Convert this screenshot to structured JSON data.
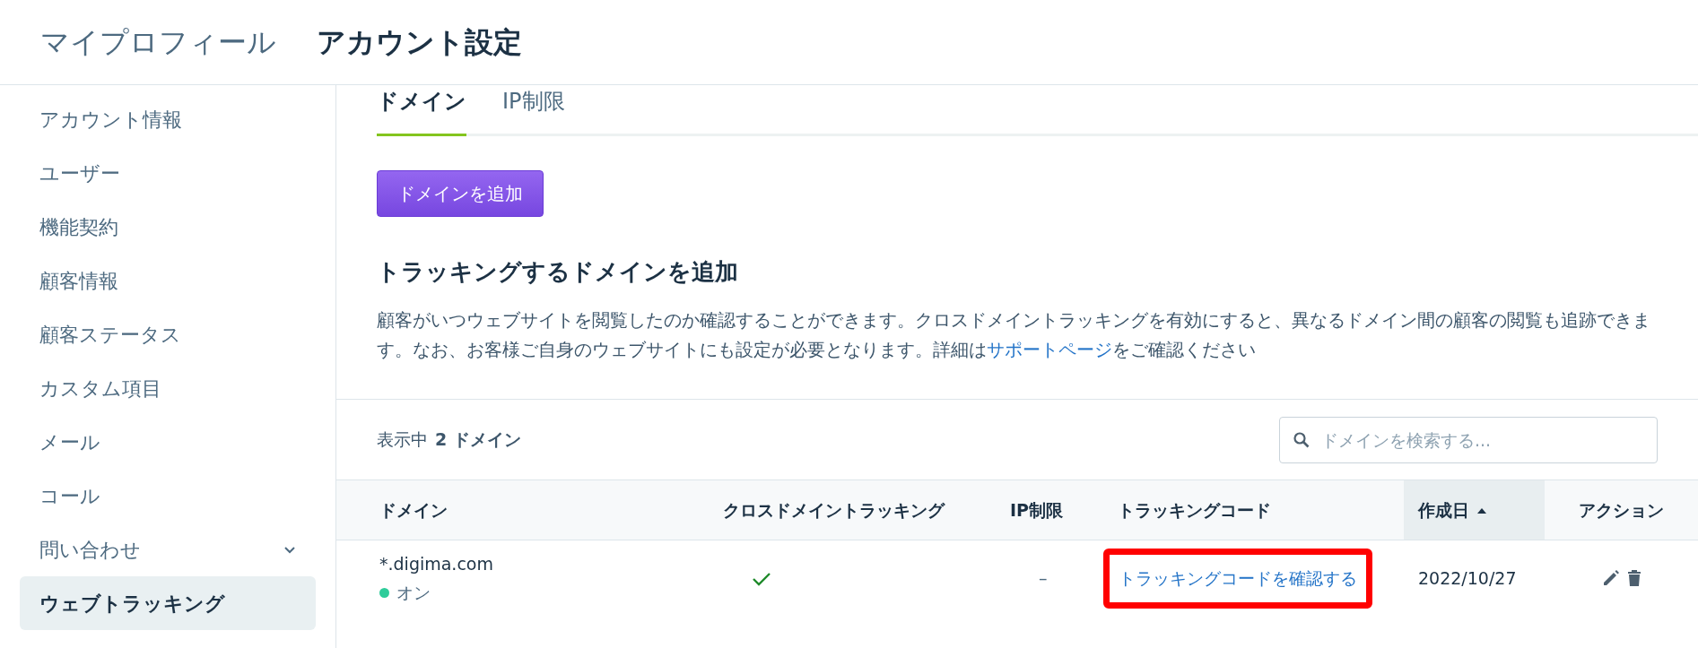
{
  "header": {
    "breadcrumbs": [
      {
        "label": "マイプロフィール",
        "selected": false
      },
      {
        "label": "アカウント設定",
        "selected": true
      }
    ]
  },
  "sidebar": {
    "items": [
      {
        "label": "アカウント情報",
        "selected": false,
        "expandable": false
      },
      {
        "label": "ユーザー",
        "selected": false,
        "expandable": false
      },
      {
        "label": "機能契約",
        "selected": false,
        "expandable": false
      },
      {
        "label": "顧客情報",
        "selected": false,
        "expandable": false
      },
      {
        "label": "顧客ステータス",
        "selected": false,
        "expandable": false
      },
      {
        "label": "カスタム項目",
        "selected": false,
        "expandable": false
      },
      {
        "label": "メール",
        "selected": false,
        "expandable": false
      },
      {
        "label": "コール",
        "selected": false,
        "expandable": false
      },
      {
        "label": "問い合わせ",
        "selected": false,
        "expandable": true
      },
      {
        "label": "ウェブトラッキング",
        "selected": true,
        "expandable": false
      }
    ]
  },
  "tabs": [
    {
      "label": "ドメイン",
      "selected": true
    },
    {
      "label": "IP制限",
      "selected": false
    }
  ],
  "add_button": "ドメインを追加",
  "section": {
    "title": "トラッキングするドメインを追加",
    "description_before": "顧客がいつウェブサイトを閲覧したのか確認することができます。クロスドメイントラッキングを有効にすると、異なるドメイン間の顧客の閲覧も追跡できます。なお、お客様ご自身のウェブサイトにも設定が必要となります。詳細は",
    "link": "サポートページ",
    "description_after": "をご確認ください"
  },
  "toolbar": {
    "count_label": "表示中",
    "count": "2 ドメイン",
    "search": {
      "placeholder": "ドメインを検索する..."
    }
  },
  "table": {
    "columns": [
      {
        "label": "ドメイン",
        "sorted": false
      },
      {
        "label": "クロスドメイントラッキング",
        "sorted": false
      },
      {
        "label": "IP制限",
        "sorted": false
      },
      {
        "label": "トラッキングコード",
        "sorted": false
      },
      {
        "label": "作成日",
        "sorted": true
      },
      {
        "label": "アクション",
        "sorted": false
      }
    ],
    "rows": [
      {
        "domain": "*.digima.com",
        "status": {
          "label": "オン",
          "color": "#2ecc9a"
        },
        "cross_domain": true,
        "ip_restriction": "–",
        "tracking_code": "トラッキングコードを確認する",
        "highlighted": true,
        "created": "2022/10/27"
      }
    ]
  }
}
